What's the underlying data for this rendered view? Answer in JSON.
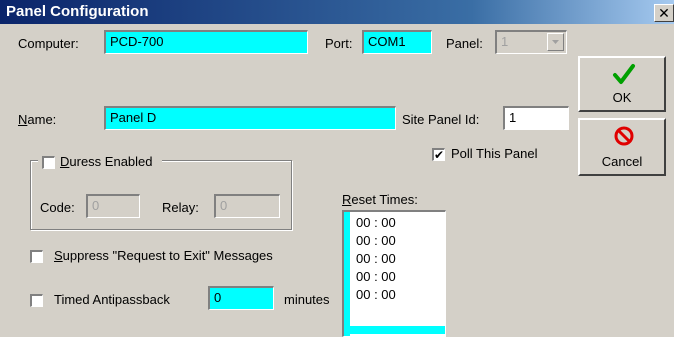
{
  "window": {
    "title": "Panel Configuration",
    "close_glyph": "✕"
  },
  "computer": {
    "label": "Computer:",
    "value": "PCD-700"
  },
  "port": {
    "label": "Port:",
    "value": "COM1"
  },
  "panel_select": {
    "label": "Panel:",
    "value": "1"
  },
  "name": {
    "label_u": "N",
    "label_rest": "ame:",
    "value": "Panel D"
  },
  "site_panel_id": {
    "label": "Site Panel Id:",
    "value": "1"
  },
  "poll": {
    "label": "Poll This Panel",
    "checked": true
  },
  "duress": {
    "label_u": "D",
    "label_rest": "uress Enabled",
    "code_label": "Code:",
    "code_value": "0",
    "relay_label": "Relay:",
    "relay_value": "0"
  },
  "reset_times": {
    "label_u": "R",
    "label_rest": "eset Times:",
    "items": [
      "00 : 00",
      "00 : 00",
      "00 : 00",
      "00 : 00",
      "00 : 00"
    ]
  },
  "suppress": {
    "label_u": "S",
    "label_rest": "uppress \"Request to Exit\" Messages"
  },
  "antipassback": {
    "label": "Timed Antipassback",
    "value": "0",
    "suffix": "minutes"
  },
  "buttons": {
    "ok": "OK",
    "cancel": "Cancel"
  },
  "colors": {
    "field_bg": "#00ffff",
    "dialog_bg": "#d4d0c8",
    "title_bg": "#0a246a"
  }
}
